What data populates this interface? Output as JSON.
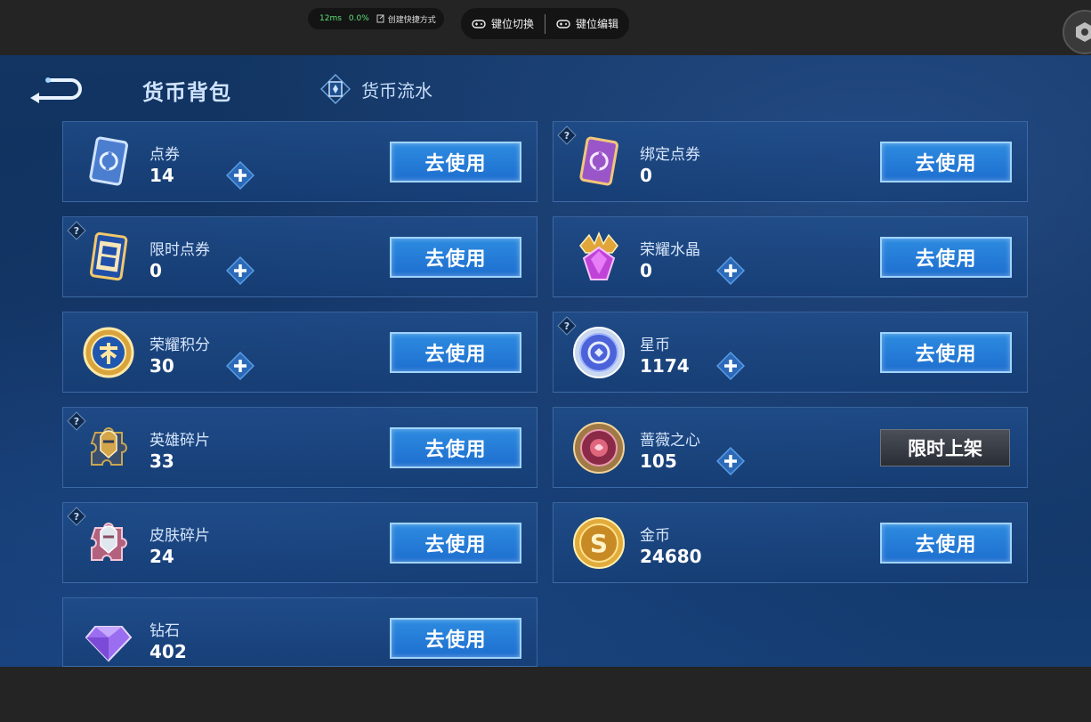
{
  "overlay": {
    "latency": "12ms",
    "loss": "0.0%",
    "shortcut_label": "创建快捷方式",
    "key_switch_label": "键位切换",
    "key_edit_label": "键位编辑"
  },
  "header": {
    "title": "货币背包",
    "flow_tab_label": "货币流水"
  },
  "cards": [
    {
      "name": "点券",
      "count": "14",
      "button": "去使用",
      "plus": true,
      "help": false,
      "icon": "voucher-icon"
    },
    {
      "name": "绑定点券",
      "count": "0",
      "button": "去使用",
      "plus": false,
      "help": true,
      "icon": "bound-voucher-icon"
    },
    {
      "name": "限时点券",
      "count": "0",
      "button": "去使用",
      "plus": true,
      "help": true,
      "icon": "limited-voucher-icon"
    },
    {
      "name": "荣耀水晶",
      "count": "0",
      "button": "去使用",
      "plus": true,
      "help": false,
      "icon": "glory-crystal-icon"
    },
    {
      "name": "荣耀积分",
      "count": "30",
      "button": "去使用",
      "plus": true,
      "help": false,
      "icon": "glory-points-icon"
    },
    {
      "name": "星币",
      "count": "1174",
      "button": "去使用",
      "plus": true,
      "help": true,
      "icon": "star-coin-icon"
    },
    {
      "name": "英雄碎片",
      "count": "33",
      "button": "去使用",
      "plus": false,
      "help": true,
      "icon": "hero-fragment-icon"
    },
    {
      "name": "蔷薇之心",
      "count": "105",
      "button": "限时上架",
      "plus": true,
      "help": false,
      "icon": "rose-heart-icon"
    },
    {
      "name": "皮肤碎片",
      "count": "24",
      "button": "去使用",
      "plus": false,
      "help": true,
      "icon": "skin-fragment-icon"
    },
    {
      "name": "金币",
      "count": "24680",
      "button": "去使用",
      "plus": false,
      "help": false,
      "icon": "gold-coin-icon"
    },
    {
      "name": "钻石",
      "count": "402",
      "button": "去使用",
      "plus": false,
      "help": false,
      "icon": "diamond-icon"
    }
  ]
}
